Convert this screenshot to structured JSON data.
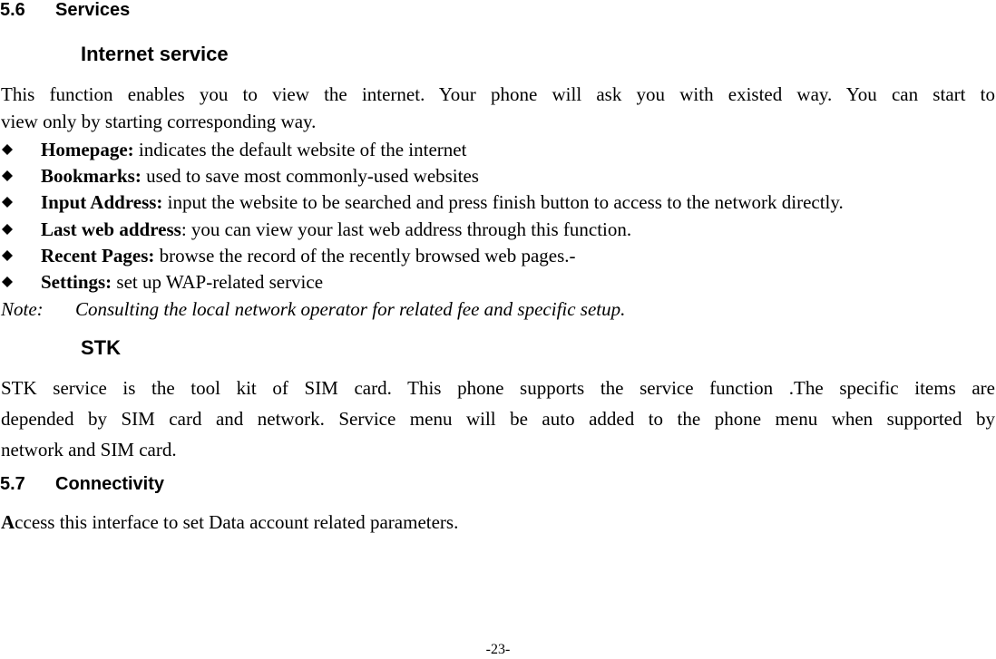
{
  "section_5_6": {
    "number": "5.6",
    "title": "Services"
  },
  "internet_service": {
    "heading": "Internet service",
    "intro_line1": "This function enables you to view the internet. Your phone will ask you with existed way. You can start to",
    "intro_line2": "view only by starting corresponding way.",
    "items": [
      {
        "term": "Homepage:",
        "desc": " indicates the default website of the internet"
      },
      {
        "term": "Bookmarks:",
        "desc": " used to save most commonly-used websites"
      },
      {
        "term": "Input Address:",
        "desc": " input the website to be searched and press finish button to access to the network directly."
      },
      {
        "term": "Last web address",
        "desc": ": you can view your last web address through this function."
      },
      {
        "term": "Recent Pages:",
        "desc": " browse the record of the recently browsed web pages.-"
      },
      {
        "term": "Settings:",
        "desc": " set up WAP-related service"
      }
    ],
    "bullet_icon": "black-diamond",
    "note_label": "Note:",
    "note_text": "Consulting the local network operator for related fee and specific setup."
  },
  "stk": {
    "heading": "STK",
    "line1": "STK service is the tool kit of SIM card. This phone supports the service function .The specific items are",
    "line2": "depended by SIM card and network. Service menu will be auto added to the phone menu when supported by",
    "line3": "network and SIM card."
  },
  "section_5_7": {
    "number": "5.7",
    "title": "Connectivity",
    "body_first_letter": "A",
    "body_rest": "ccess this interface to set Data account related parameters."
  },
  "footer": {
    "page_number": "-23-"
  }
}
